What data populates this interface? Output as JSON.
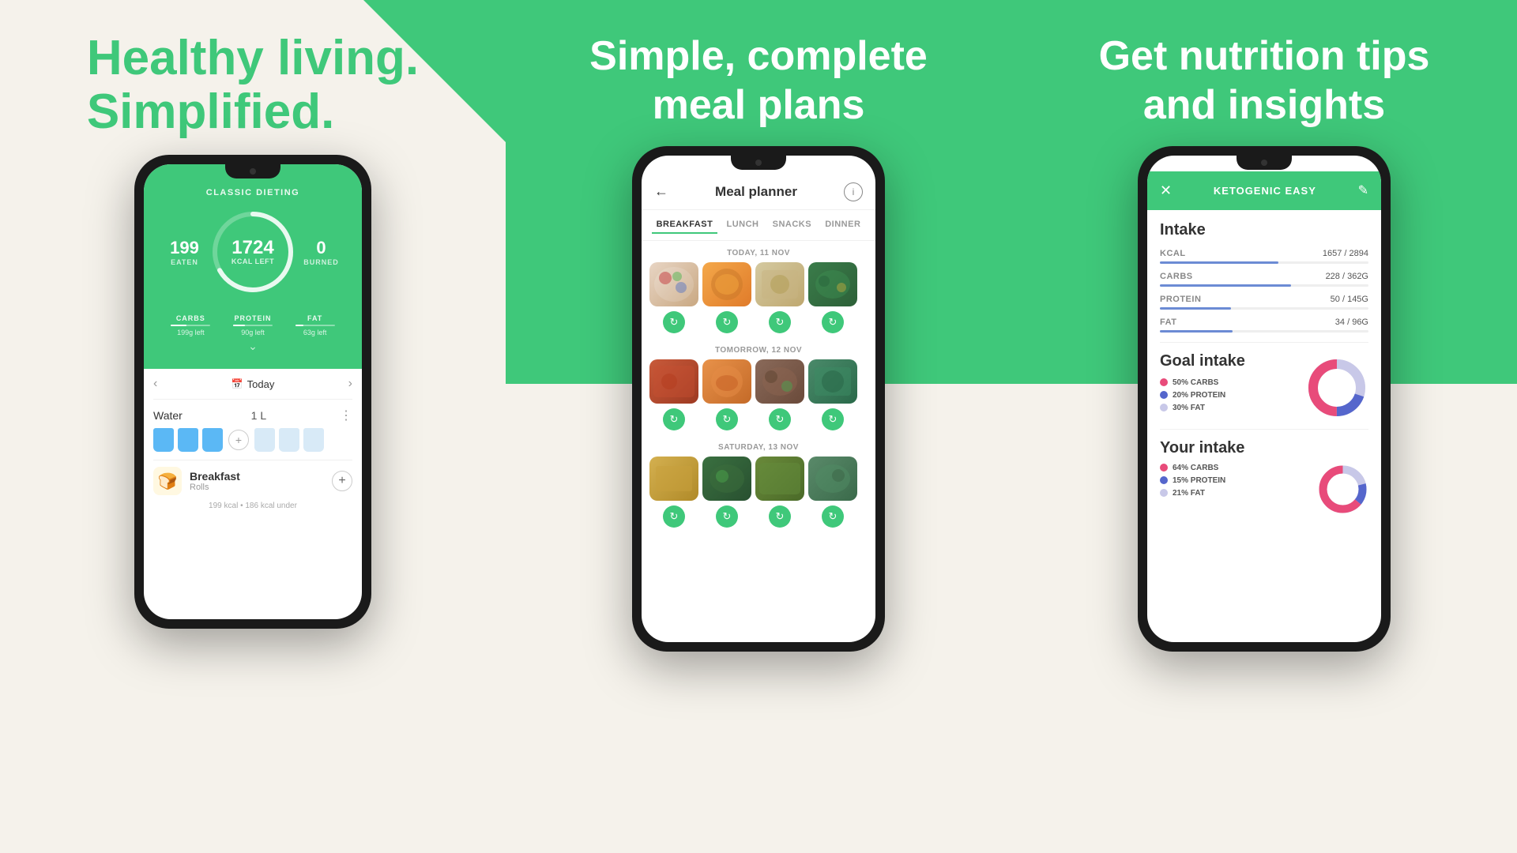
{
  "panel1": {
    "heading_line1": "Healthy living.",
    "heading_line2": "Simplified.",
    "plan_label": "CLASSIC DIETING",
    "eaten_label": "EATEN",
    "eaten_val": "199",
    "kcal_left": "1724",
    "kcal_left_label": "KCAL LEFT",
    "burned_label": "BURNED",
    "burned_val": "0",
    "macro1_name": "CARBS",
    "macro1_left": "199g left",
    "macro1_pct": 40,
    "macro2_name": "PROTEIN",
    "macro2_left": "90g left",
    "macro2_pct": 30,
    "macro3_name": "FAT",
    "macro3_left": "63g left",
    "macro3_pct": 20,
    "nav_today": "Today",
    "water_label": "Water",
    "water_amount": "1 L",
    "breakfast_title": "Breakfast",
    "breakfast_sub": "Rolls",
    "kcal_info": "199 kcal • 186 kcal under"
  },
  "panel2": {
    "heading": "Simple, complete\nmeal plans",
    "plan_title": "Meal planner",
    "tab_breakfast": "BREAKFAST",
    "tab_lunch": "LUNCH",
    "tab_snacks": "SNACKS",
    "tab_dinner": "DINNER",
    "day1_label": "TODAY, 11 NOV",
    "day2_label": "TOMORROW, 12 NOV",
    "day3_label": "SATURDAY, 13 NOV"
  },
  "panel3": {
    "heading": "Get nutrition tips\nand insights",
    "plan_title": "KETOGENIC EASY",
    "intake_title": "Intake",
    "kcal_label": "KCAL",
    "kcal_values": "1657 / 2894",
    "kcal_pct": 57,
    "carbs_label": "CARBS",
    "carbs_values": "228 / 362G",
    "carbs_pct": 63,
    "protein_label": "PROTEIN",
    "protein_values": "50 / 145G",
    "protein_pct": 34,
    "fat_label": "FAT",
    "fat_values": "34 / 96G",
    "fat_pct": 35,
    "goal_title": "Goal intake",
    "goal_carbs_pct": "50% CARBS",
    "goal_protein_pct": "20% PROTEIN",
    "goal_fat_pct": "30% FAT",
    "your_intake_title": "Your intake",
    "your_carbs_pct": "64% CARBS",
    "your_protein_pct": "15% PROTEIN",
    "your_fat_pct": "21% FAT"
  },
  "colors": {
    "green": "#3fc87a",
    "bar_blue": "#6c8bd4",
    "carbs_pink": "#e84b7a",
    "protein_blue": "#5566cc",
    "fat_lavender": "#c8c8e8"
  }
}
